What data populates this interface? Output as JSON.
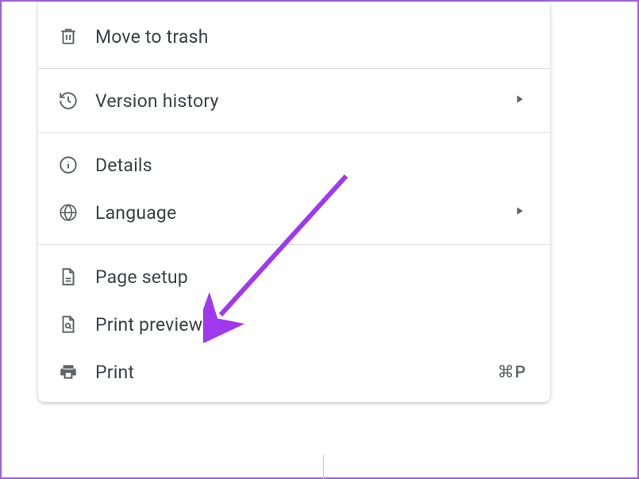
{
  "menu": {
    "sections": [
      {
        "items": [
          {
            "id": "move-to-trash",
            "icon": "trash",
            "label": "Move to trash",
            "submenu": false,
            "shortcut": ""
          }
        ]
      },
      {
        "items": [
          {
            "id": "version-history",
            "icon": "history",
            "label": "Version history",
            "submenu": true,
            "shortcut": ""
          }
        ]
      },
      {
        "items": [
          {
            "id": "details",
            "icon": "info",
            "label": "Details",
            "submenu": false,
            "shortcut": ""
          },
          {
            "id": "language",
            "icon": "globe",
            "label": "Language",
            "submenu": true,
            "shortcut": ""
          }
        ]
      },
      {
        "items": [
          {
            "id": "page-setup",
            "icon": "page",
            "label": "Page setup",
            "submenu": false,
            "shortcut": ""
          },
          {
            "id": "print-preview",
            "icon": "preview",
            "label": "Print preview",
            "submenu": false,
            "shortcut": ""
          },
          {
            "id": "print",
            "icon": "printer",
            "label": "Print",
            "submenu": false,
            "shortcut": "⌘P"
          }
        ]
      }
    ]
  },
  "annotation": {
    "color": "#a038f0",
    "target": "page-setup"
  }
}
